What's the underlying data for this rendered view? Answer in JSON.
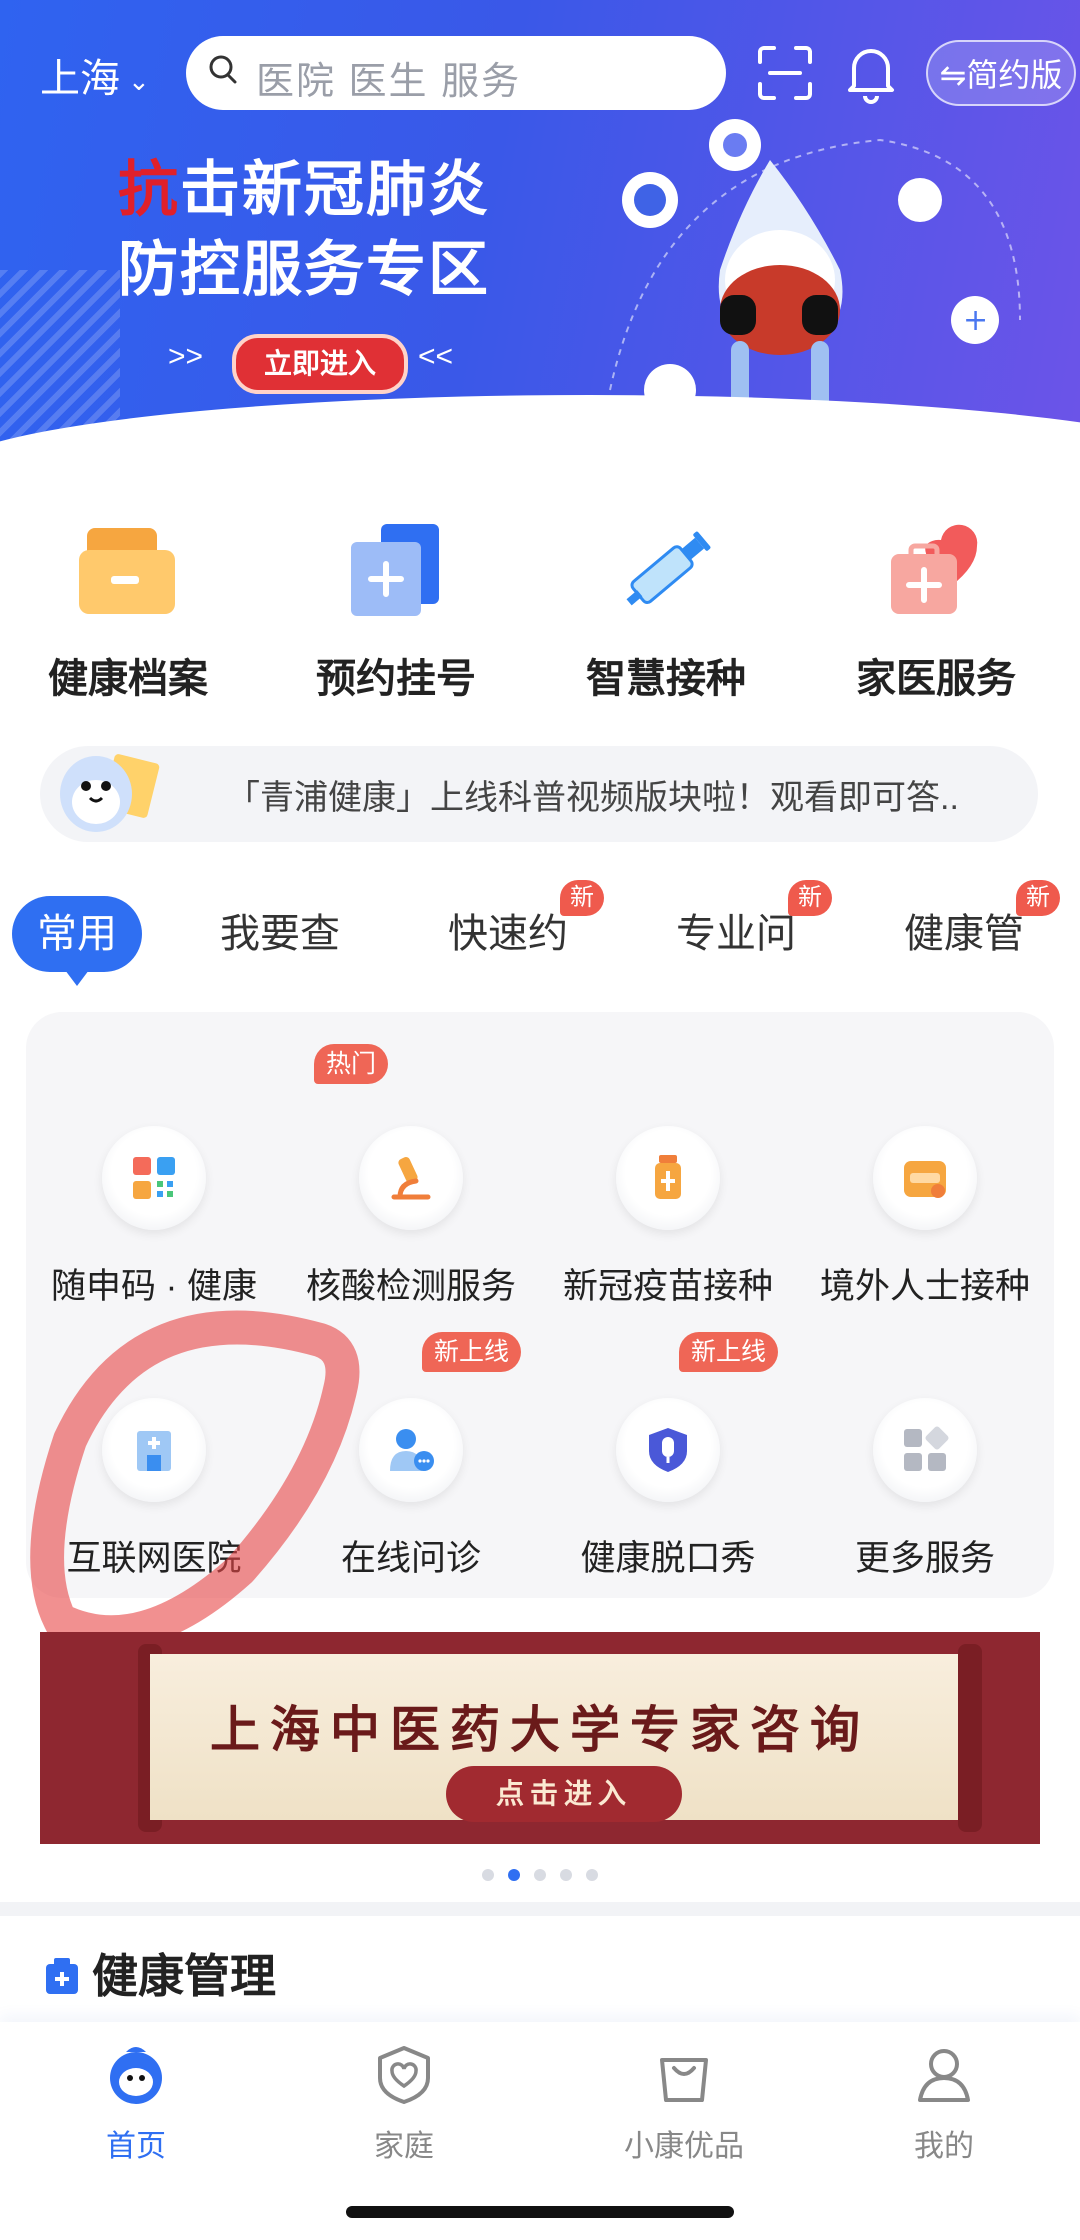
{
  "header": {
    "city": "上海",
    "search_placeholder": "医院 医生 服务",
    "simple_mode_label": "⇋简约版"
  },
  "banner": {
    "headline_red": "抗",
    "headline_part1": "击新冠肺炎",
    "headline_line2": "防控服务专区",
    "enter_label": "立即进入",
    "arrows_left": ">>",
    "arrows_right": "<<"
  },
  "quick_nav": [
    {
      "label": "健康档案",
      "icon": "folder-icon"
    },
    {
      "label": "预约挂号",
      "icon": "register-icon"
    },
    {
      "label": "智慧接种",
      "icon": "syringe-icon"
    },
    {
      "label": "家医服务",
      "icon": "family-doctor-icon"
    }
  ],
  "notice": {
    "text": "「青浦健康」上线科普视频版块啦！观看即可答.."
  },
  "tabs": [
    {
      "label": "常用",
      "active": true,
      "badge": ""
    },
    {
      "label": "我要查",
      "active": false,
      "badge": ""
    },
    {
      "label": "快速约",
      "active": false,
      "badge": "新"
    },
    {
      "label": "专业问",
      "active": false,
      "badge": "新"
    },
    {
      "label": "健康管",
      "active": false,
      "badge": "新"
    }
  ],
  "services": [
    {
      "label": "随申码 · 健康",
      "badge": "",
      "icon": "qr-code-icon"
    },
    {
      "label": "核酸检测服务",
      "badge": "热门",
      "icon": "microscope-icon"
    },
    {
      "label": "新冠疫苗接种",
      "badge": "",
      "icon": "vaccine-bottle-icon"
    },
    {
      "label": "境外人士接种",
      "badge": "",
      "icon": "covid-overseas-icon"
    },
    {
      "label": "互联网医院",
      "badge": "",
      "icon": "hospital-icon"
    },
    {
      "label": "在线问诊",
      "badge": "新上线",
      "icon": "doctor-chat-icon"
    },
    {
      "label": "健康脱口秀",
      "badge": "新上线",
      "icon": "microphone-shield-icon"
    },
    {
      "label": "更多服务",
      "badge": "",
      "icon": "more-grid-icon"
    }
  ],
  "promo": {
    "title": "上海中医药大学专家咨询",
    "cta": "点击进入",
    "page_count": 5,
    "active_page": 2
  },
  "section": {
    "title": "健康管理"
  },
  "bottom_nav": [
    {
      "label": "首页",
      "active": true,
      "icon": "home-mascot-icon"
    },
    {
      "label": "家庭",
      "active": false,
      "icon": "family-heart-icon"
    },
    {
      "label": "小康优品",
      "active": false,
      "icon": "shopping-bag-icon"
    },
    {
      "label": "我的",
      "active": false,
      "icon": "profile-icon"
    }
  ],
  "colors": {
    "accent": "#2f6ff2",
    "badge": "#ef5a4d",
    "promo_bg": "#8e2730"
  }
}
